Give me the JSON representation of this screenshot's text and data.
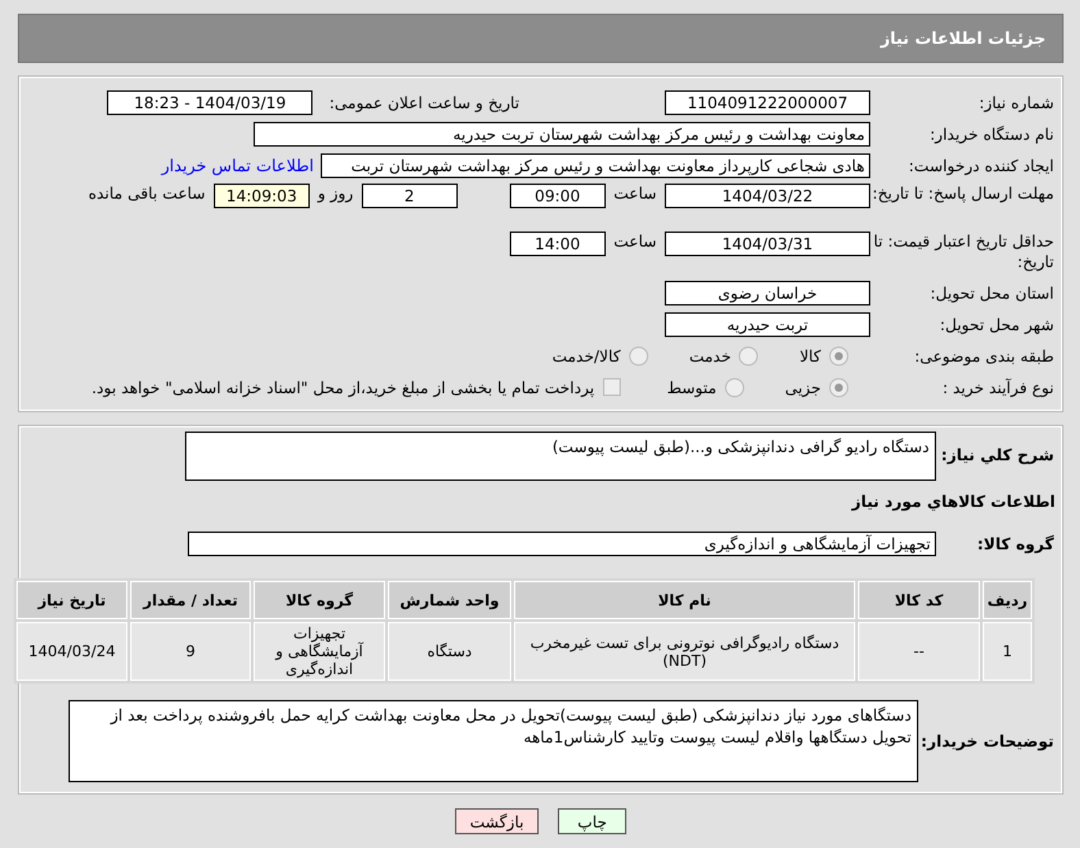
{
  "header": {
    "title": "جزئیات اطلاعات نیاز"
  },
  "details": {
    "need_number": {
      "label": "شماره نیاز:",
      "value": "1104091222000007"
    },
    "announce": {
      "label": "تاریخ و ساعت اعلان عمومی:",
      "value": "1404/03/19 - 18:23"
    },
    "buyer": {
      "label": "نام دستگاه خریدار:",
      "value": "معاونت بهداشت و رئیس مرکز بهداشت شهرستان تربت حیدریه"
    },
    "creator": {
      "label": "ایجاد کننده درخواست:",
      "value": "هادی شجاعی کارپرداز معاونت بهداشت و رئیس مرکز بهداشت شهرستان تربت",
      "link": "اطلاعات تماس خریدار"
    },
    "deadline": {
      "label": "مهلت ارسال پاسخ: تا تاریخ:",
      "date": "1404/03/22",
      "time_label": "ساعت",
      "time": "09:00",
      "days": "2",
      "days_label": "روز و",
      "remaining": "14:09:03",
      "remaining_label": "ساعت باقی مانده"
    },
    "validity": {
      "label": "حداقل تاریخ اعتبار قیمت: تا تاریخ:",
      "date": "1404/03/31",
      "time_label": "ساعت",
      "time": "14:00"
    },
    "province": {
      "label": "استان محل تحویل:",
      "value": "خراسان رضوی"
    },
    "city": {
      "label": "شهر محل تحویل:",
      "value": "تربت حیدریه"
    },
    "category": {
      "label": "طبقه بندی موضوعی:",
      "options": [
        {
          "label": "کالا",
          "selected": true
        },
        {
          "label": "خدمت",
          "selected": false
        },
        {
          "label": "کالا/خدمت",
          "selected": false
        }
      ]
    },
    "process": {
      "label": "نوع فرآیند خرید :",
      "options": [
        {
          "label": "جزیی",
          "selected": true
        },
        {
          "label": "متوسط",
          "selected": false
        }
      ],
      "treasury": {
        "label": "پرداخت تمام یا بخشی از مبلغ خرید،از محل \"اسناد خزانه اسلامی\" خواهد بود.",
        "checked": false
      }
    }
  },
  "needs": {
    "description": {
      "label": "شرح کلي نیاز:",
      "value": "دستگاه رادیو گرافی دندانپزشکی و...(طبق لیست پیوست)"
    },
    "section_title": "اطلاعات کالاهاي مورد نیاز",
    "goods_group": {
      "label": "گروه کالا:",
      "value": "تجهیزات آزمایشگاهی و اندازه‌گیری"
    },
    "table": {
      "columns": [
        "ردیف",
        "کد کالا",
        "نام کالا",
        "واحد شمارش",
        "گروه کالا",
        "تعداد / مقدار",
        "تاریخ نیاز"
      ],
      "rows": [
        [
          "1",
          "--",
          "دستگاه رادیوگرافی نوترونی برای تست غیرمخرب (NDT)",
          "دستگاه",
          "تجهیزات آزمایشگاهی و اندازه‌گیری",
          "9",
          "1404/03/24"
        ]
      ]
    },
    "buyer_notes": {
      "label": "توضیحات خریدار:",
      "value": "دستگاهای مورد نیاز دندانپزشکی (طبق لیست پیوست)تحویل در محل معاونت بهداشت کرایه حمل بافروشنده پرداخت بعد از تحویل دستگاهها واقلام  لیست پیوست وتایید کارشناس1ماهه"
    }
  },
  "buttons": [
    {
      "kind": "print",
      "label": "چاپ"
    },
    {
      "kind": "back",
      "label": "بازگشت"
    }
  ]
}
